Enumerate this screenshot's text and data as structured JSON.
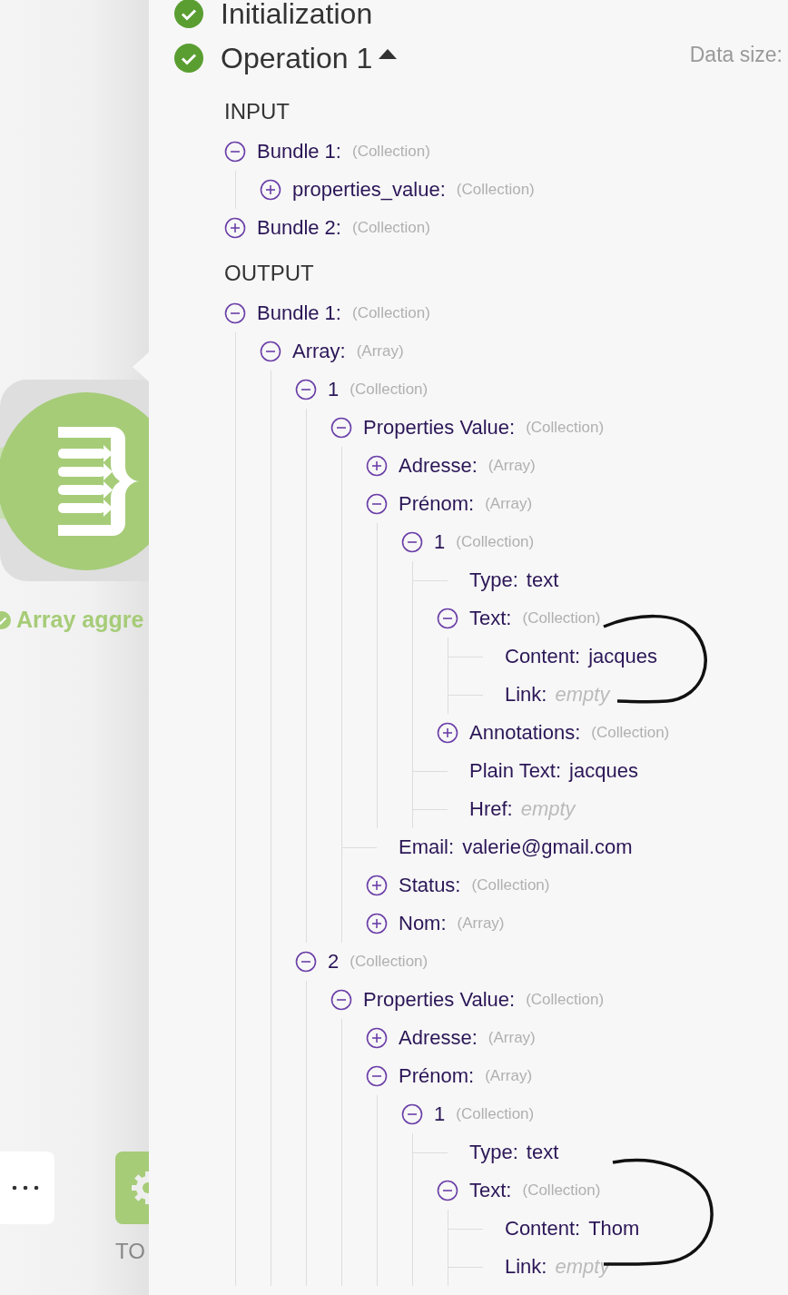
{
  "canvas": {
    "module_label": "Array aggre",
    "tools_label": "TO"
  },
  "panel": {
    "initialization": {
      "label": "Initialization"
    },
    "operation": {
      "label": "Operation 1",
      "expanded": true,
      "data_size_label": "Data size:"
    },
    "sections": [
      {
        "heading": "INPUT",
        "tree": [
          {
            "kind": "collection",
            "key": "Bundle 1:",
            "type": "(Collection)",
            "expanded": true,
            "children": [
              {
                "kind": "collection",
                "key": "properties_value:",
                "type": "(Collection)",
                "expanded": false
              }
            ]
          },
          {
            "kind": "collection",
            "key": "Bundle 2:",
            "type": "(Collection)",
            "expanded": false
          }
        ]
      },
      {
        "heading": "OUTPUT",
        "tree": [
          {
            "kind": "collection",
            "key": "Bundle 1:",
            "type": "(Collection)",
            "expanded": true,
            "children": [
              {
                "kind": "collection",
                "key": "Array:",
                "type": "(Array)",
                "expanded": true,
                "children": [
                  {
                    "kind": "collection",
                    "key": "1",
                    "type": "(Collection)",
                    "expanded": true,
                    "children": [
                      {
                        "kind": "collection",
                        "key": "Properties Value:",
                        "type": "(Collection)",
                        "expanded": true,
                        "children": [
                          {
                            "kind": "collection",
                            "key": "Adresse:",
                            "type": "(Array)",
                            "expanded": false
                          },
                          {
                            "kind": "collection",
                            "key": "Prénom:",
                            "type": "(Array)",
                            "expanded": true,
                            "children": [
                              {
                                "kind": "collection",
                                "key": "1",
                                "type": "(Collection)",
                                "expanded": true,
                                "children": [
                                  {
                                    "kind": "value",
                                    "key": "Type:",
                                    "value": "text"
                                  },
                                  {
                                    "kind": "collection",
                                    "key": "Text:",
                                    "type": "(Collection)",
                                    "expanded": true,
                                    "children": [
                                      {
                                        "kind": "value",
                                        "key": "Content:",
                                        "value": "jacques"
                                      },
                                      {
                                        "kind": "empty",
                                        "key": "Link:",
                                        "value": "empty"
                                      }
                                    ]
                                  },
                                  {
                                    "kind": "collection",
                                    "key": "Annotations:",
                                    "type": "(Collection)",
                                    "expanded": false
                                  },
                                  {
                                    "kind": "value",
                                    "key": "Plain Text:",
                                    "value": "jacques"
                                  },
                                  {
                                    "kind": "empty",
                                    "key": "Href:",
                                    "value": "empty"
                                  }
                                ]
                              }
                            ]
                          },
                          {
                            "kind": "value",
                            "key": "Email:",
                            "value": "valerie@gmail.com"
                          },
                          {
                            "kind": "collection",
                            "key": "Status:",
                            "type": "(Collection)",
                            "expanded": false
                          },
                          {
                            "kind": "collection",
                            "key": "Nom:",
                            "type": "(Array)",
                            "expanded": false
                          }
                        ]
                      }
                    ]
                  },
                  {
                    "kind": "collection",
                    "key": "2",
                    "type": "(Collection)",
                    "expanded": true,
                    "children": [
                      {
                        "kind": "collection",
                        "key": "Properties Value:",
                        "type": "(Collection)",
                        "expanded": true,
                        "children": [
                          {
                            "kind": "collection",
                            "key": "Adresse:",
                            "type": "(Array)",
                            "expanded": false
                          },
                          {
                            "kind": "collection",
                            "key": "Prénom:",
                            "type": "(Array)",
                            "expanded": true,
                            "children": [
                              {
                                "kind": "collection",
                                "key": "1",
                                "type": "(Collection)",
                                "expanded": true,
                                "children": [
                                  {
                                    "kind": "value",
                                    "key": "Type:",
                                    "value": "text"
                                  },
                                  {
                                    "kind": "collection",
                                    "key": "Text:",
                                    "type": "(Collection)",
                                    "expanded": true,
                                    "children": [
                                      {
                                        "kind": "value",
                                        "key": "Content:",
                                        "value": "Thom"
                                      },
                                      {
                                        "kind": "empty",
                                        "key": "Link:",
                                        "value": "empty"
                                      }
                                    ]
                                  }
                                ]
                              }
                            ]
                          }
                        ]
                      }
                    ]
                  }
                ]
              }
            ]
          }
        ]
      }
    ]
  }
}
